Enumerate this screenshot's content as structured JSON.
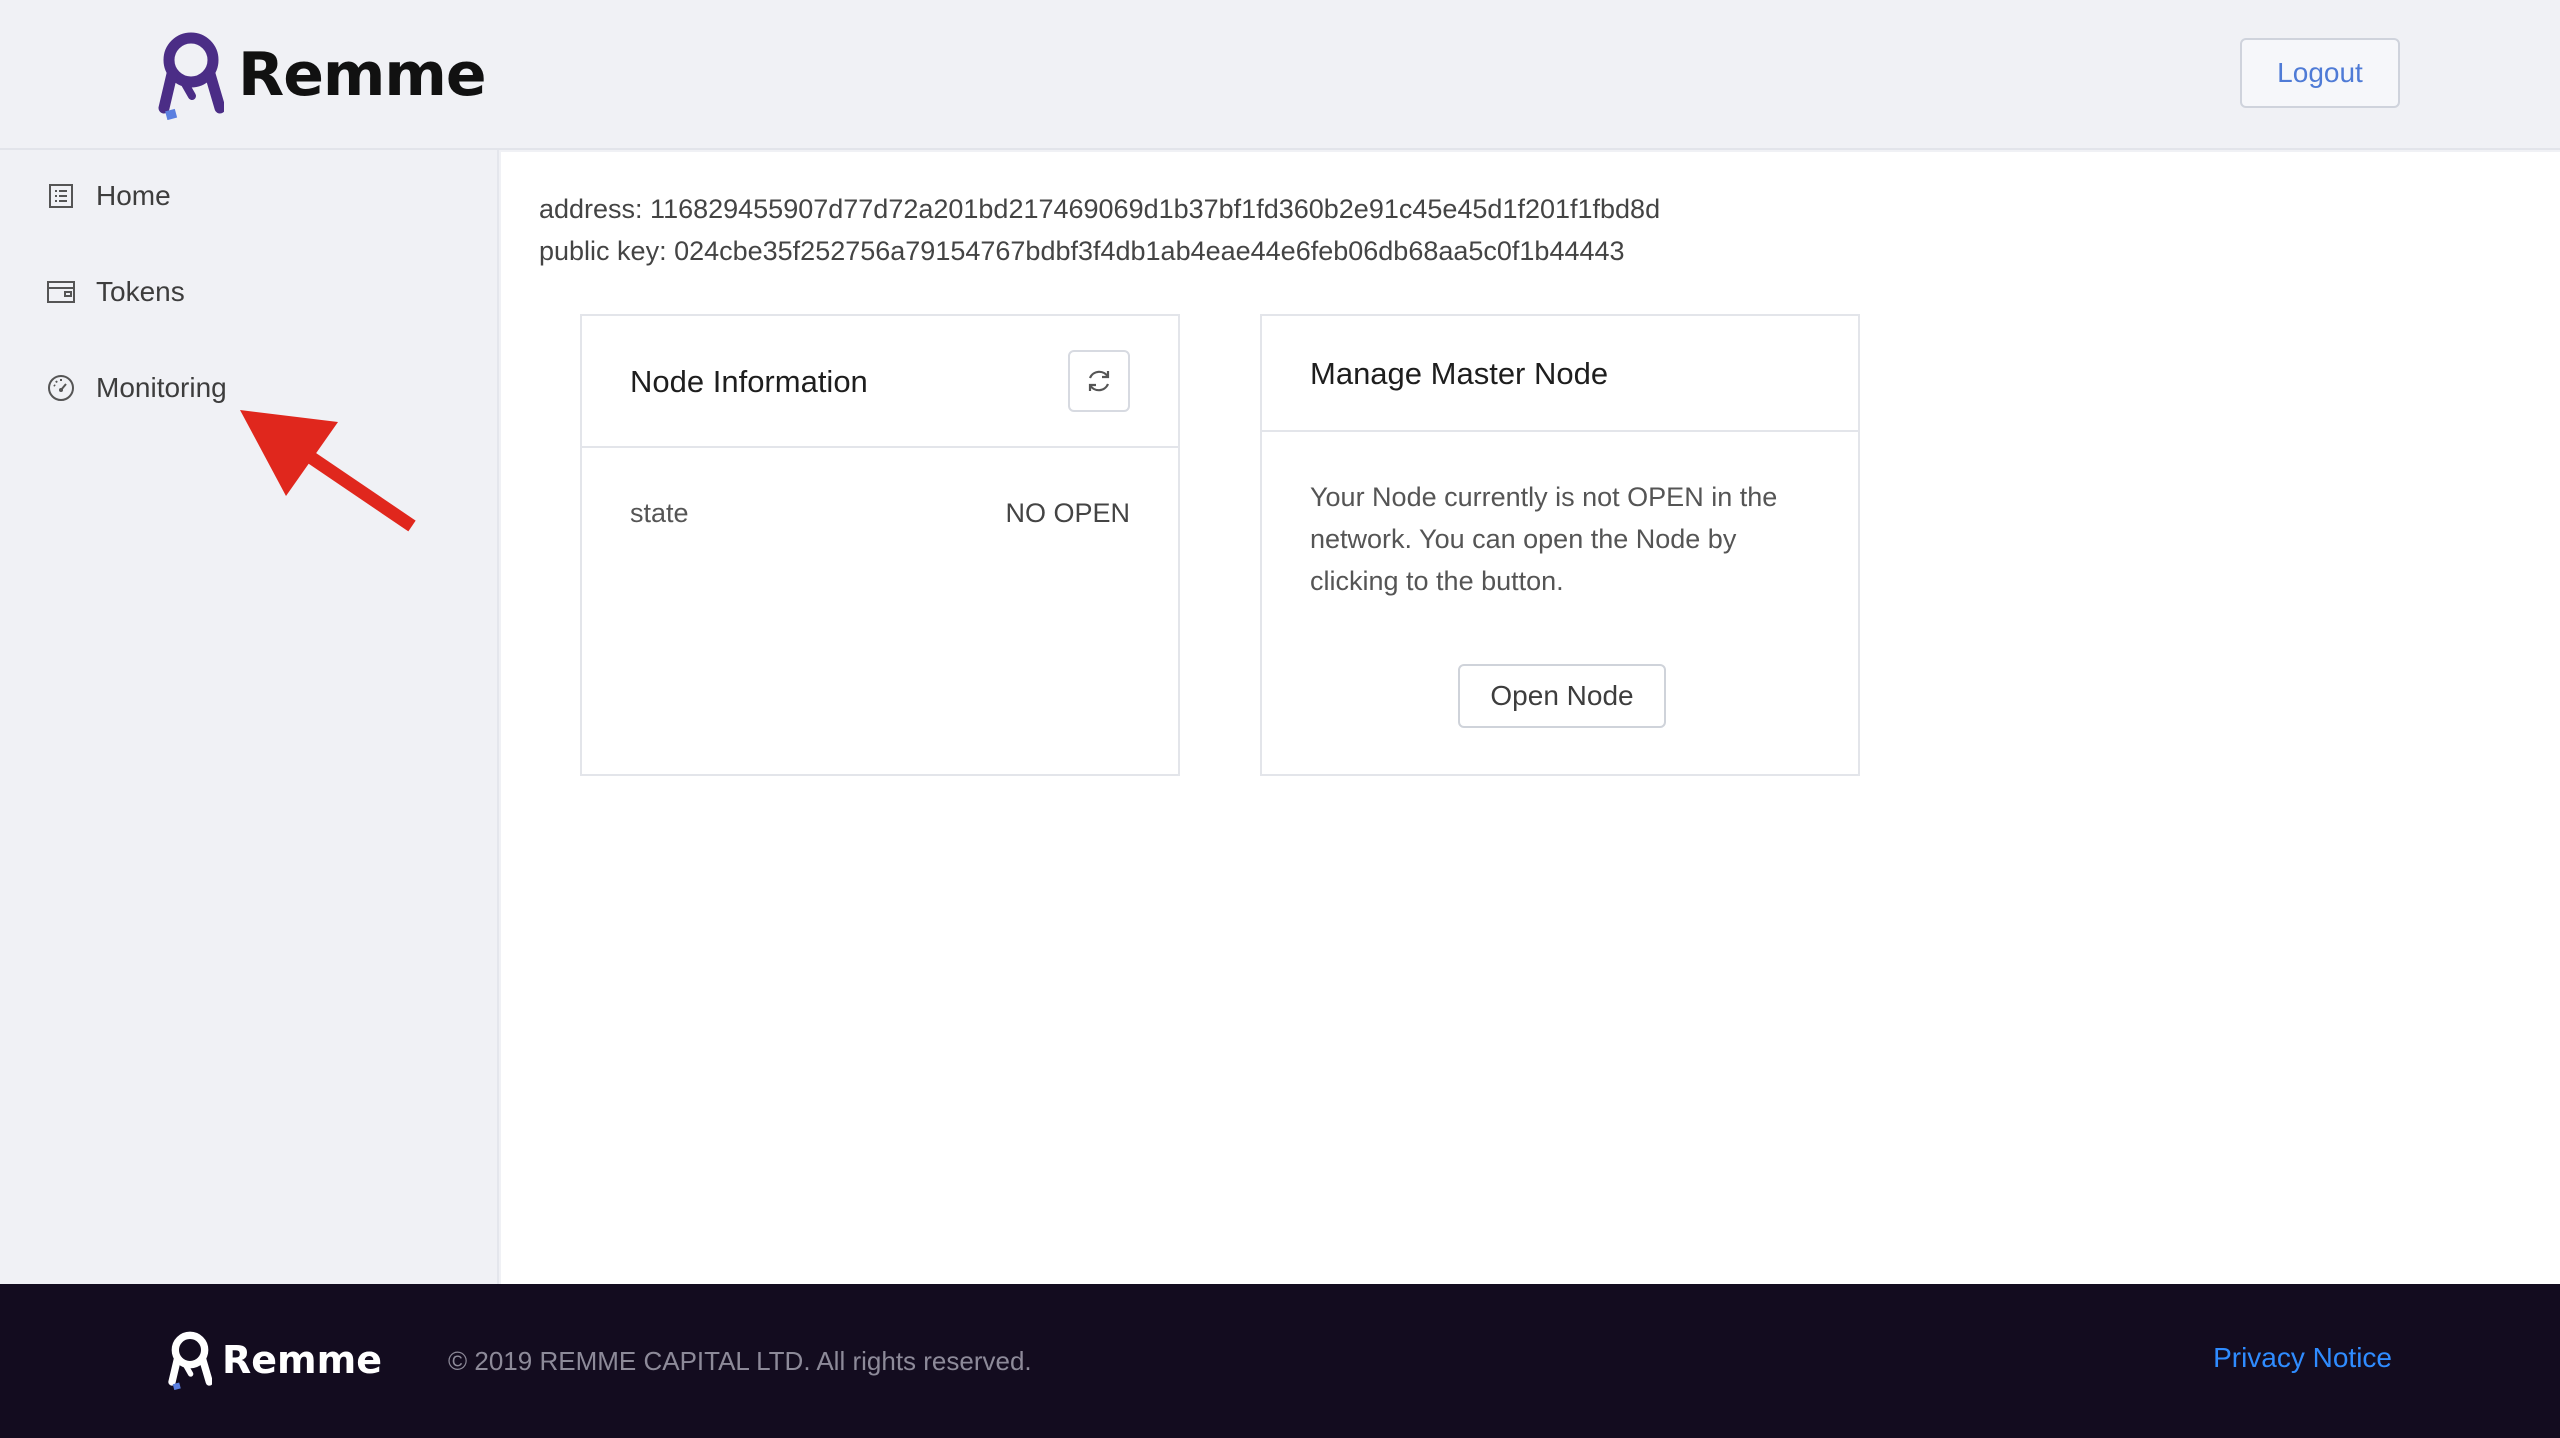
{
  "header": {
    "brand": "Remme",
    "logout_label": "Logout"
  },
  "sidebar": {
    "items": [
      {
        "label": "Home",
        "icon": "list-icon"
      },
      {
        "label": "Tokens",
        "icon": "wallet-icon"
      },
      {
        "label": "Monitoring",
        "icon": "dashboard-icon"
      }
    ]
  },
  "account": {
    "address_line": "address: 116829455907d77d72a201bd217469069d1b37bf1fd360b2e91c45e45d1f201f1fbd8d",
    "public_key_line": "public key: 024cbe35f252756a79154767bdbf3f4db1ab4eae44e6feb06db68aa5c0f1b44443"
  },
  "node_info": {
    "title": "Node Information",
    "rows": [
      {
        "key": "state",
        "value": "NO OPEN"
      }
    ]
  },
  "master_node": {
    "title": "Manage Master Node",
    "description": "Your Node currently is not OPEN in the network. You can open the Node by clicking to the button.",
    "button_label": "Open Node"
  },
  "footer": {
    "brand": "Remme",
    "copyright": "© 2019 REMME CAPITAL LTD. All rights reserved.",
    "privacy_label": "Privacy Notice"
  },
  "colors": {
    "brand_purple": "#4b2d86",
    "brand_accent": "#5b7fe0",
    "annotation_arrow": "#e0271d",
    "link_blue": "#2f8cff",
    "footer_bg": "#130c1f"
  }
}
